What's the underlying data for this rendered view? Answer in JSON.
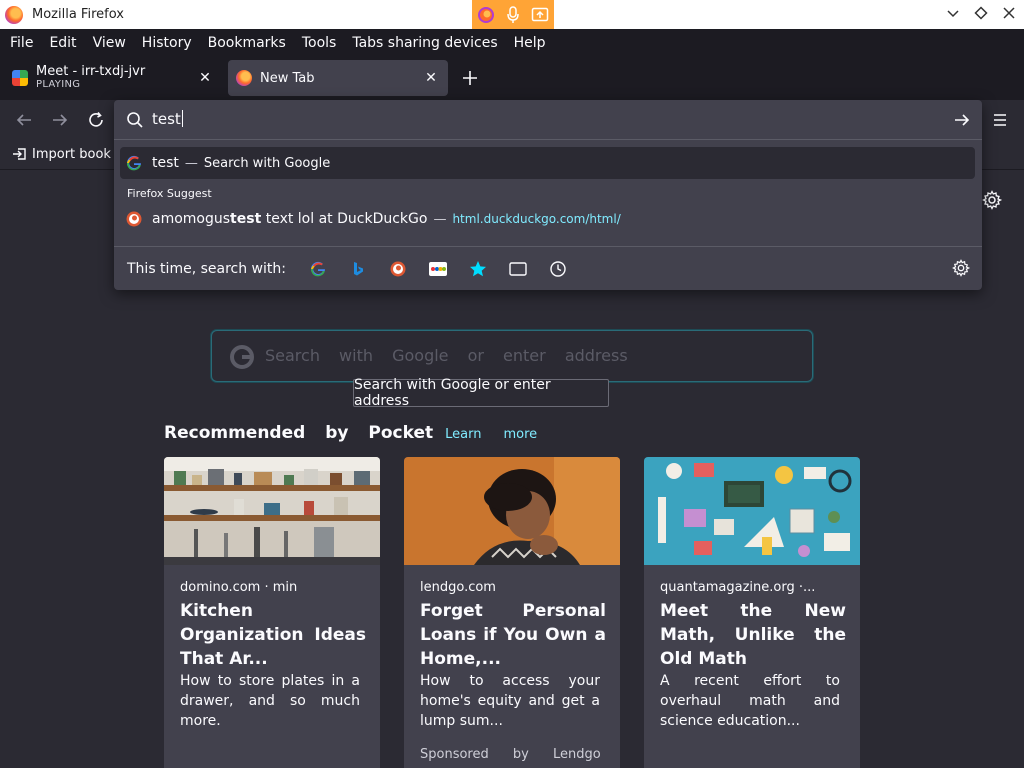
{
  "window": {
    "title": "Mozilla Firefox"
  },
  "menubar": {
    "items": [
      "File",
      "Edit",
      "View",
      "History",
      "Bookmarks",
      "Tools",
      "Tabs sharing devices",
      "Help"
    ]
  },
  "tabs": [
    {
      "title": "Meet - irr-txdj-jvr",
      "subtitle": "PLAYING",
      "active": false
    },
    {
      "title": "New Tab",
      "active": true
    }
  ],
  "bookmarks": {
    "import_label": "Import book"
  },
  "urlbar": {
    "value": "test",
    "search_suggestion": {
      "term": "test",
      "separator": "—",
      "action": "Search with Google"
    },
    "group_label": "Firefox Suggest",
    "firefox_suggest": {
      "prefix": "amomogus",
      "match": "test",
      "suffix": " text lol at DuckDuckGo",
      "separator": "—",
      "url": "html.duckduckgo.com/html/"
    },
    "one_off_label": "This time, search with:",
    "engines": [
      "google-icon",
      "bing-icon",
      "duckduckgo-icon",
      "ebay-icon",
      "bookmarks-star-icon",
      "tabs-icon",
      "history-icon"
    ]
  },
  "newtab": {
    "search_placeholder": "Search with Google or enter address",
    "tooltip": "Search with Google or enter address",
    "pocket": {
      "title": "Recommended by Pocket",
      "learn": "Learn",
      "more": "more"
    },
    "cards": [
      {
        "source": "domino.com  ·   min",
        "headline": "Kitchen Organization Ideas That Ar...",
        "excerpt": "How to store plates in a drawer, and so much more.",
        "sponsor": ""
      },
      {
        "source": "lendgo.com",
        "headline": "Forget Personal Loans if You Own a Home,...",
        "excerpt": "How to access your home's equity and get a lump sum...",
        "sponsor": "Sponsored by Lendgo"
      },
      {
        "source": "quantamagazine.org  ·...",
        "headline": "Meet the New Math, Unlike the Old Math",
        "excerpt": "A recent effort to overhaul math and science education...",
        "sponsor": ""
      }
    ]
  },
  "colors": {
    "accent": "#80ebff",
    "sharing_indicator": "#ffa436",
    "chrome": "#1c1b22",
    "panel": "#42414d",
    "page": "#2b2a33"
  }
}
